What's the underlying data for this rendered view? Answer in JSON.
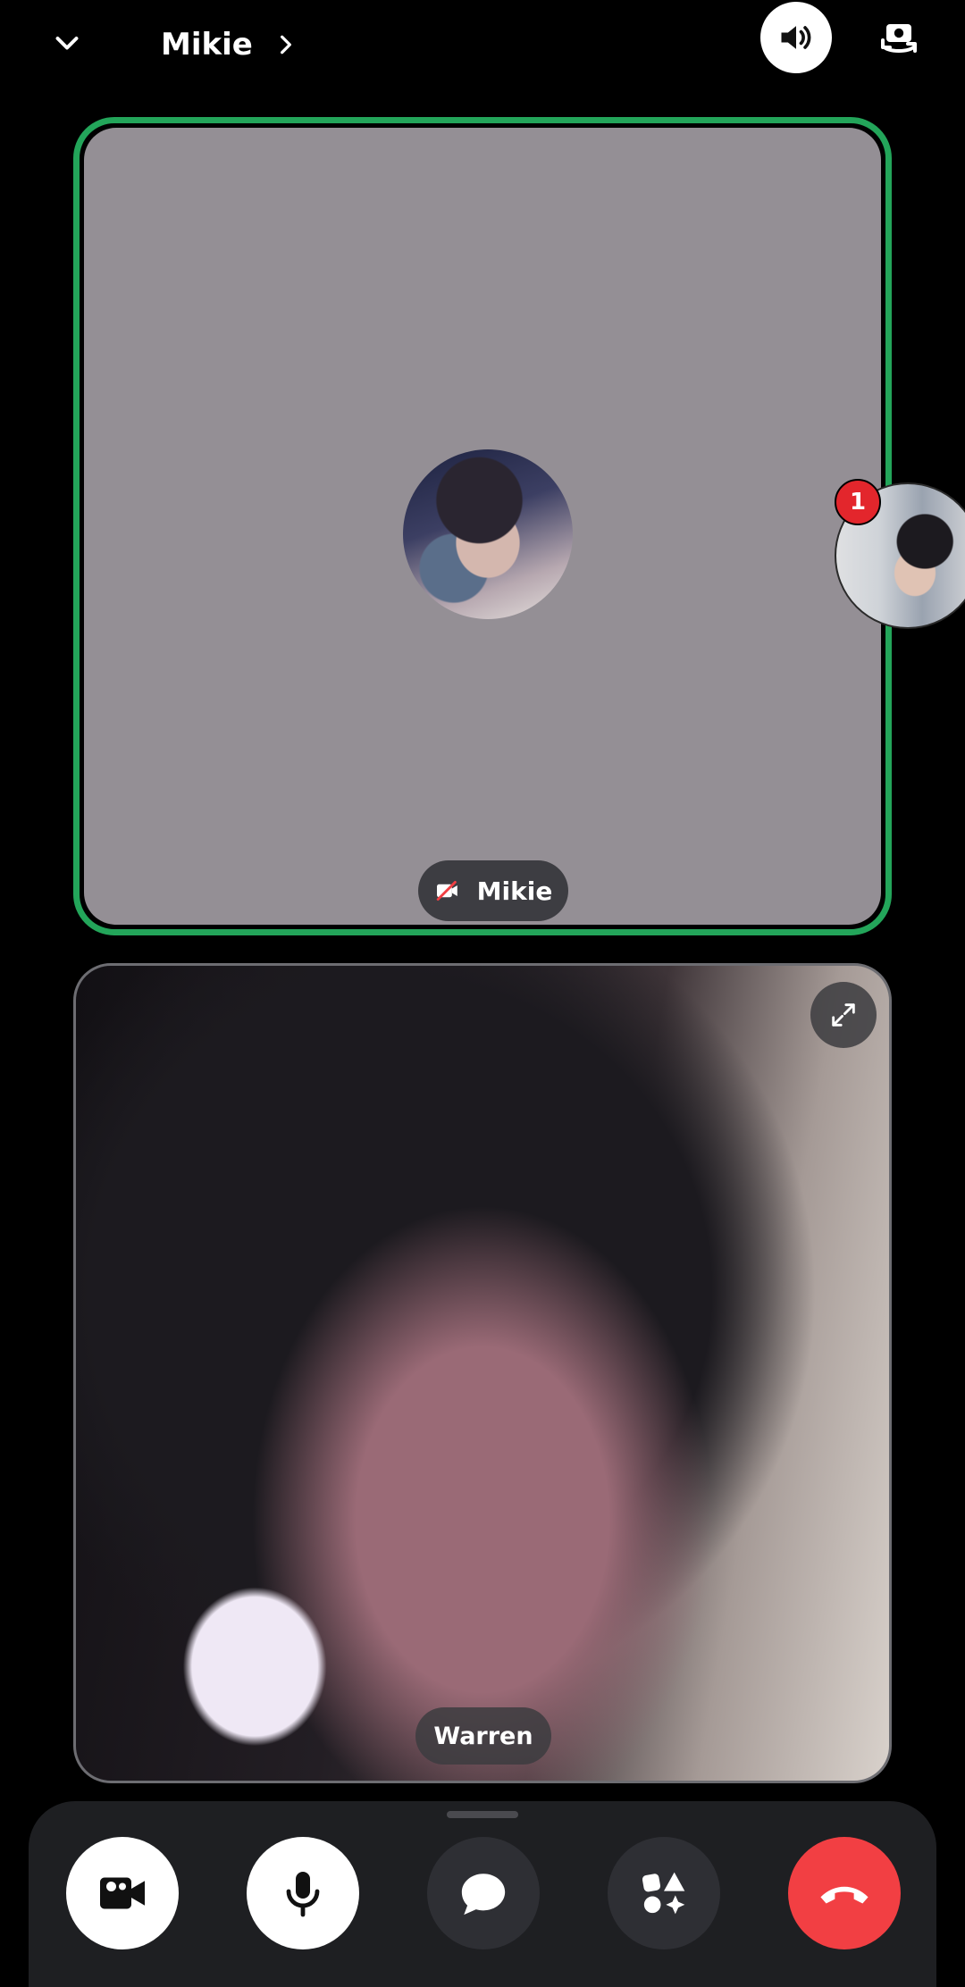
{
  "header": {
    "title": "Mikie",
    "icons": {
      "collapse": "chevron-down-icon",
      "title_arrow": "chevron-right-icon",
      "speaker": "speaker-icon",
      "camera_flip": "camera-flip-icon"
    }
  },
  "tiles": {
    "remote": {
      "name": "Mikie",
      "status_icon": "camera-off-icon",
      "speaking_border_color": "#23a55a"
    },
    "local": {
      "name": "Warren",
      "action_icon": "expand-icon"
    }
  },
  "floating": {
    "badge": "1"
  },
  "controls": {
    "buttons": [
      "video-icon",
      "microphone-icon",
      "chat-icon",
      "activities-icon",
      "end-call-icon"
    ],
    "end_color": "#f23f43"
  }
}
